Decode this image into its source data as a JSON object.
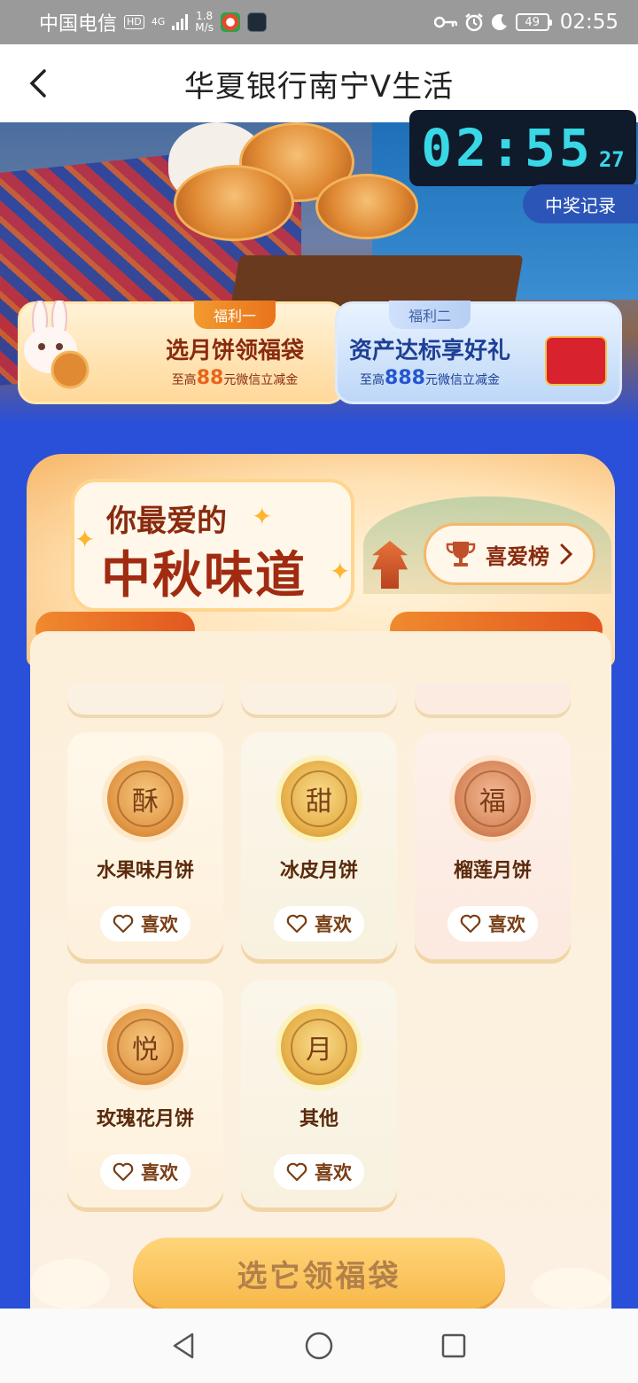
{
  "status_bar": {
    "carrier": "中国电信",
    "hd_badge": "HD",
    "network": "4G",
    "speed_value": "1.8",
    "speed_unit": "M/s",
    "battery": "49",
    "time": "02:55"
  },
  "nav": {
    "title": "华夏银行南宁V生活"
  },
  "hero": {
    "timer_main": "02:55",
    "timer_seconds": "27",
    "record_label": "中奖记录"
  },
  "welfare": [
    {
      "tag": "福利一",
      "title": "选月饼领福袋",
      "sub_prefix": "至高",
      "amount": "88",
      "sub_suffix": "元微信立减金"
    },
    {
      "tag": "福利二",
      "title": "资产达标享好礼",
      "sub_prefix": "至高",
      "amount": "888",
      "sub_suffix": "元微信立减金"
    }
  ],
  "section": {
    "title_line1": "你最爱的",
    "title_line2": "中秋味道",
    "ranking_label": "喜爱榜"
  },
  "items": [
    {
      "glyph": "酥",
      "name": "水果味月饼",
      "like": "喜欢"
    },
    {
      "glyph": "甜",
      "name": "冰皮月饼",
      "like": "喜欢"
    },
    {
      "glyph": "福",
      "name": "榴莲月饼",
      "like": "喜欢"
    },
    {
      "glyph": "悦",
      "name": "玫瑰花月饼",
      "like": "喜欢"
    },
    {
      "glyph": "月",
      "name": "其他",
      "like": "喜欢"
    }
  ],
  "cta": {
    "label": "选它领福袋"
  },
  "colors": {
    "page_bg": "#2a4fd9",
    "accent_orange": "#e8641a",
    "accent_brown": "#8a2a0e",
    "timer_cyan": "#38d8e6"
  }
}
